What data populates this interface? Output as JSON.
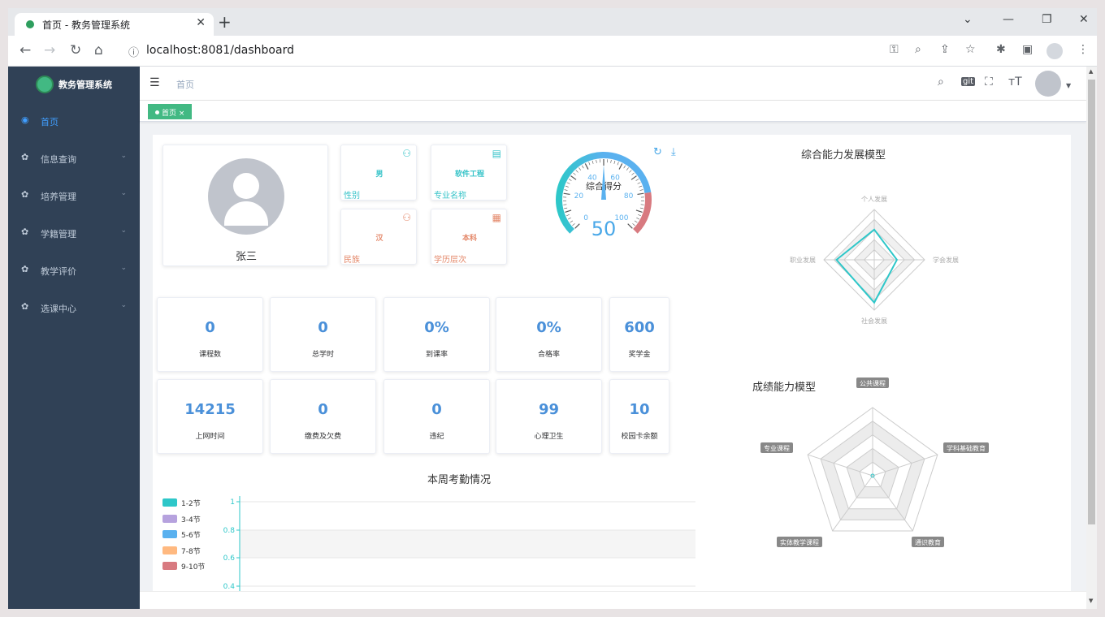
{
  "browser": {
    "tab_title": "首页 - 教务管理系统",
    "tab_close": "✕",
    "new_tab": "+",
    "url_info": "ⓘ",
    "url": "localhost:8081/dashboard"
  },
  "app": {
    "logo_text": "教务管理系统",
    "menu": [
      {
        "label": "首页",
        "icon": "dashboard-icon",
        "active": true
      },
      {
        "label": "信息查询",
        "icon": "gear-icon"
      },
      {
        "label": "培养管理",
        "icon": "gear-icon"
      },
      {
        "label": "学籍管理",
        "icon": "gear-icon"
      },
      {
        "label": "教学评价",
        "icon": "gear-icon"
      },
      {
        "label": "选课中心",
        "icon": "gear-icon"
      }
    ],
    "breadcrumb": "首页",
    "tag_label": "首页 ×",
    "accent": "#42b983"
  },
  "profile": {
    "name": "张三",
    "gender": {
      "value": "男",
      "label": "性别"
    },
    "major": {
      "value": "软件工程",
      "label": "专业名称"
    },
    "ethnicity": {
      "value": "汉",
      "label": "民族"
    },
    "education": {
      "value": "本科",
      "label": "学历层次"
    }
  },
  "gauge": {
    "title": "综合得分",
    "value": "50",
    "value_num": 50,
    "ticks": [
      "0",
      "20",
      "40",
      "60",
      "80",
      "100"
    ]
  },
  "stats_row1": [
    {
      "value": "0",
      "label": "课程数"
    },
    {
      "value": "0",
      "label": "总学时"
    },
    {
      "value": "0%",
      "label": "到课率"
    },
    {
      "value": "0%",
      "label": "合格率"
    },
    {
      "value": "600",
      "label": "奖学金"
    }
  ],
  "stats_row2": [
    {
      "value": "14215",
      "label": "上网时间"
    },
    {
      "value": "0",
      "label": "缴费及欠费"
    },
    {
      "value": "0",
      "label": "违纪"
    },
    {
      "value": "99",
      "label": "心理卫生"
    },
    {
      "value": "10",
      "label": "校园卡余额"
    }
  ],
  "attendance": {
    "title": "本周考勤情况",
    "legend": [
      {
        "label": "1-2节",
        "color": "#2ec7c9"
      },
      {
        "label": "3-4节",
        "color": "#b6a2de"
      },
      {
        "label": "5-6节",
        "color": "#5ab1ef"
      },
      {
        "label": "7-8节",
        "color": "#ffb980"
      },
      {
        "label": "9-10节",
        "color": "#d87a80"
      }
    ],
    "y_ticks": [
      "1",
      "0.8",
      "0.6",
      "0.4"
    ]
  },
  "radar1": {
    "title": "综合能力发展模型",
    "labels": [
      "个人发展",
      "学会发展",
      "社会发展",
      "职业发展"
    ]
  },
  "radar2": {
    "title": "成绩能力模型",
    "labels": [
      "公共课程",
      "学科基础教育",
      "通识教育",
      "实体教学课程",
      "专业课程"
    ]
  }
}
